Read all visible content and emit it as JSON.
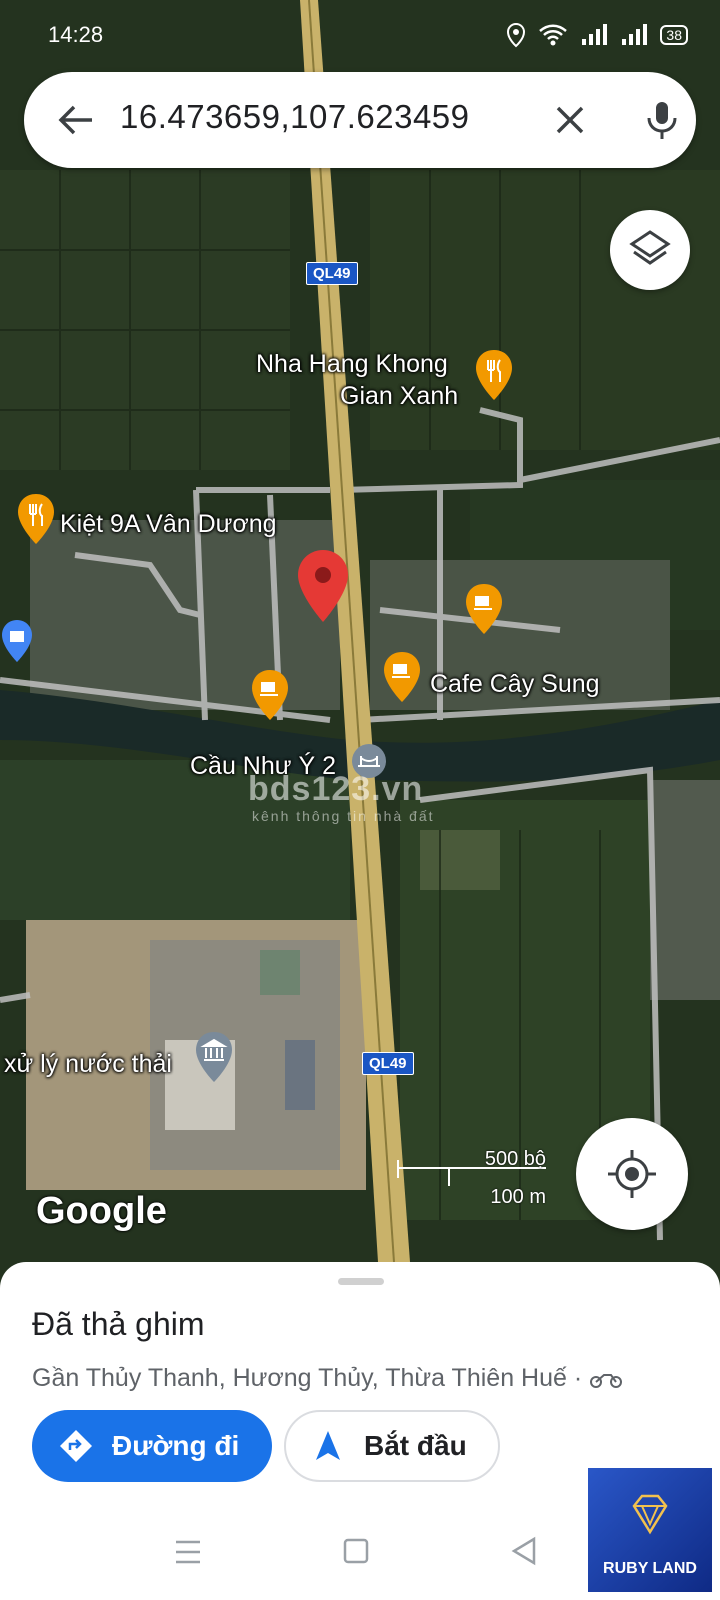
{
  "status_bar": {
    "time": "14:28",
    "battery": "38"
  },
  "search": {
    "query": "16.473659,107.623459"
  },
  "map": {
    "road_shield_1": "QL49",
    "road_shield_2": "QL49",
    "places": {
      "restaurant_1": "Nha Hang Khong\nGian Xanh",
      "restaurant_1_line1": "Nha Hang Khong",
      "restaurant_1_line2": "Gian Xanh",
      "restaurant_2": "Kiệt 9A Vân Dương",
      "cafe": "Cafe Cây Sung",
      "bridge": "Cầu Như Ý 2",
      "plant": "xử lý nước thải"
    },
    "watermark": "bds123.vn",
    "watermark_sub": "kênh thông tin nhà đất",
    "logo": "Google",
    "scale_top": "500 bộ",
    "scale_bottom": "100 m"
  },
  "sheet": {
    "title": "Đã thả ghim",
    "address": "Gần Thủy Thanh, Hương Thủy, Thừa Thiên Huế ·",
    "directions_label": "Đường đi",
    "start_label": "Bắt đầu"
  },
  "overlay_logo": {
    "text": "RUBY LAND"
  },
  "colors": {
    "accent": "#1a73e8",
    "pin": "#e53935",
    "poi": "#f29900"
  }
}
